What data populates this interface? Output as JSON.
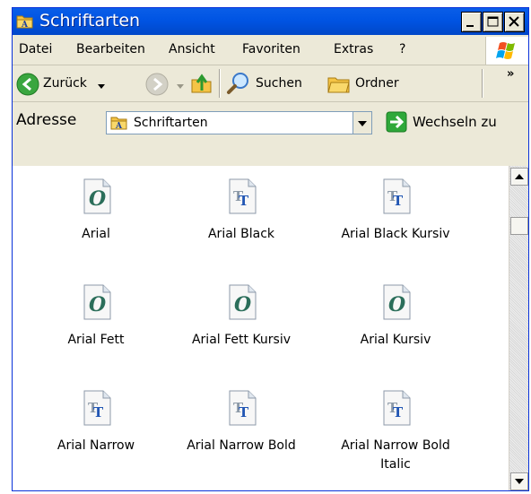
{
  "window": {
    "title": "Schriftarten"
  },
  "menu": {
    "items": [
      {
        "label": "Datei"
      },
      {
        "label": "Bearbeiten"
      },
      {
        "label": "Ansicht"
      },
      {
        "label": "Favoriten"
      },
      {
        "label": "Extras"
      },
      {
        "label": "?"
      }
    ]
  },
  "toolbar": {
    "back_label": "Zurück",
    "search_label": "Suchen",
    "folders_label": "Ordner",
    "overflow_label": "»"
  },
  "address": {
    "label": "Adresse",
    "value": "Schriftarten",
    "go_label": "Wechseln zu"
  },
  "fonts": [
    {
      "name": "Arial",
      "type": "opentype"
    },
    {
      "name": "Arial Black",
      "type": "truetype"
    },
    {
      "name": "Arial Black Kursiv",
      "type": "truetype"
    },
    {
      "name": "Arial Fett",
      "type": "opentype"
    },
    {
      "name": "Arial Fett Kursiv",
      "type": "opentype"
    },
    {
      "name": "Arial Kursiv",
      "type": "opentype"
    },
    {
      "name": "Arial Narrow",
      "type": "truetype"
    },
    {
      "name": "Arial Narrow Bold",
      "type": "truetype"
    },
    {
      "name": "Arial Narrow Bold Italic",
      "type": "truetype"
    }
  ],
  "colors": {
    "titlebar": "#0054e3",
    "window_bg": "#ece9d8",
    "close_red": "#e04b2b",
    "go_green": "#2fa83a"
  }
}
